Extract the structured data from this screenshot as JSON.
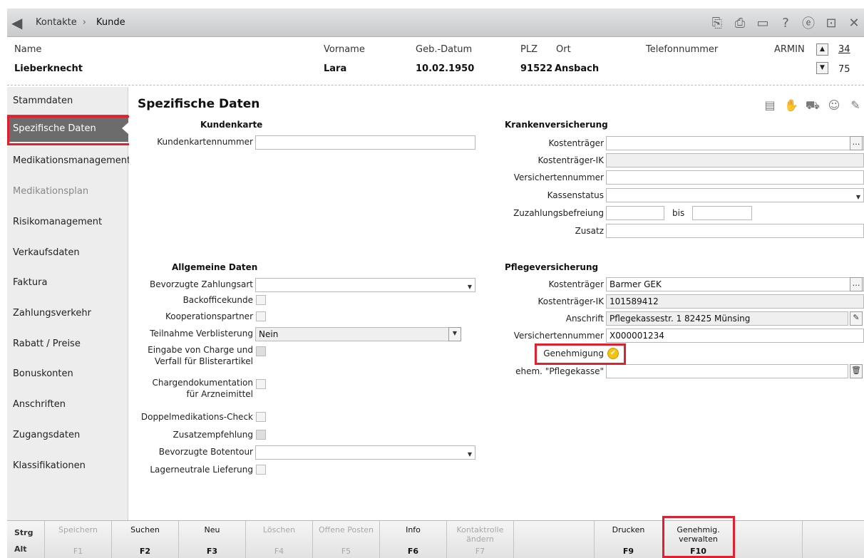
{
  "breadcrumb": {
    "root": "Kontakte",
    "separator": "›",
    "current": "Kunde"
  },
  "header": {
    "labels": {
      "name": "Name",
      "vorname": "Vorname",
      "geb": "Geb.-Datum",
      "plz": "PLZ",
      "ort": "Ort",
      "telefon": "Telefonnummer",
      "user": "ARMIN"
    },
    "values": {
      "name": "Lieberknecht",
      "vorname": "Lara",
      "geb": "10.02.1950",
      "plz": "91522",
      "ort": "Ansbach"
    },
    "counter_top": "34",
    "counter_bottom": "75"
  },
  "sidebar": {
    "items": [
      {
        "label": "Stammdaten",
        "state": "normal"
      },
      {
        "label": "Spezifische Daten",
        "state": "active"
      },
      {
        "label": "Medikationsmanagement",
        "state": "normal"
      },
      {
        "label": "Medikationsplan",
        "state": "disabled"
      },
      {
        "label": "Risikomanagement",
        "state": "normal"
      },
      {
        "label": "Verkaufsdaten",
        "state": "normal"
      },
      {
        "label": "Faktura",
        "state": "normal"
      },
      {
        "label": "Zahlungsverkehr",
        "state": "normal"
      },
      {
        "label": "Rabatt / Preise",
        "state": "normal"
      },
      {
        "label": "Bonuskonten",
        "state": "normal"
      },
      {
        "label": "Anschriften",
        "state": "normal"
      },
      {
        "label": "Zugangsdaten",
        "state": "normal"
      },
      {
        "label": "Klassifikationen",
        "state": "normal"
      }
    ]
  },
  "main": {
    "title": "Spezifische Daten",
    "kundenkarte": {
      "heading": "Kundenkarte",
      "nummer_label": "Kundenkartennummer",
      "nummer_value": ""
    },
    "allgemein": {
      "heading": "Allgemeine Daten",
      "zahlungsart": "Bevorzugte Zahlungsart",
      "backoffice": "Backofficekunde",
      "kooperation": "Kooperationspartner",
      "verblisterung": "Teilnahme Verblisterung",
      "verblisterung_value": "Nein",
      "charge_line1": "Eingabe von Charge und",
      "charge_line2": "Verfall für Blisterartikel",
      "chargendok_line1": "Chargendokumentation",
      "chargendok_line2": "für Arzneimittel",
      "doppel": "Doppelmedikations-Check",
      "zusatzempf": "Zusatzempfehlung",
      "botentour": "Bevorzugte Botentour",
      "lagerneutral": "Lagerneutrale Lieferung"
    },
    "kranken": {
      "heading": "Krankenversicherung",
      "kostentraeger": "Kostenträger",
      "kostentraeger_ik": "Kostenträger-IK",
      "versichertennummer": "Versichertennummer",
      "kassenstatus": "Kassenstatus",
      "zuzahlung": "Zuzahlungsbefreiung",
      "bis": "bis",
      "zusatz": "Zusatz"
    },
    "pflege": {
      "heading": "Pflegeversicherung",
      "kostentraeger": "Kostenträger",
      "kostentraeger_value": "Barmer GEK",
      "ik": "Kostenträger-IK",
      "ik_value": "101589412",
      "anschrift": "Anschrift",
      "anschrift_value": "Pflegekassestr. 1 82425 Münsing",
      "versichertennummer": "Versichertennummer",
      "versichertennummer_value": "X000001234",
      "genehmigung": "Genehmigung",
      "ehem": "ehem. \"Pflegekasse\""
    }
  },
  "fkeys": {
    "mod_strg": "Strg",
    "mod_alt": "Alt",
    "keys": [
      {
        "label": "Speichern",
        "key": "F1",
        "enabled": false
      },
      {
        "label": "Suchen",
        "key": "F2",
        "enabled": true
      },
      {
        "label": "Neu",
        "key": "F3",
        "enabled": true
      },
      {
        "label": "Löschen",
        "key": "F4",
        "enabled": false
      },
      {
        "label": "Offene Posten",
        "key": "F5",
        "enabled": false
      },
      {
        "label": "Info",
        "key": "F6",
        "enabled": true
      },
      {
        "label": "Kontaktrolle ändern",
        "key": "F7",
        "enabled": false
      },
      {
        "label": "",
        "key": "",
        "enabled": false
      },
      {
        "label": "Drucken",
        "key": "F9",
        "enabled": true
      },
      {
        "label": "Genehmig. verwalten",
        "key": "F10",
        "enabled": true
      },
      {
        "label": "",
        "key": "",
        "enabled": false
      },
      {
        "label": "",
        "key": "",
        "enabled": false
      }
    ]
  },
  "colors": {
    "highlight": "#e0202f",
    "active_nav": "#6c6c6c",
    "ok_badge": "#f5c20e"
  }
}
